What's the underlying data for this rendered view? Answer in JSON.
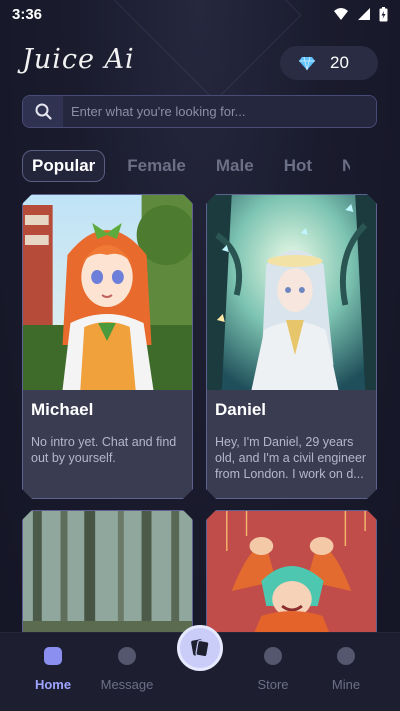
{
  "status": {
    "time": "3:36"
  },
  "header": {
    "logo": "Juice Ai",
    "gems": "20"
  },
  "search": {
    "placeholder": "Enter what you're looking for..."
  },
  "tabs": [
    {
      "label": "Popular"
    },
    {
      "label": "Female"
    },
    {
      "label": "Male"
    },
    {
      "label": "Hot"
    },
    {
      "label": "N"
    }
  ],
  "cards": [
    {
      "name": "Michael",
      "intro": "No intro yet. Chat and find out by yourself."
    },
    {
      "name": "Daniel",
      "intro": "Hey, I'm Daniel, 29 years old, and I'm a civil engineer from London. I work on d..."
    }
  ],
  "nav": [
    {
      "label": "Home"
    },
    {
      "label": "Message"
    },
    {
      "label": "Store"
    },
    {
      "label": "Mine"
    }
  ],
  "colors": {
    "accent": "#9ea4ff",
    "background": "#16172a",
    "card_info": "#3a3c52"
  }
}
